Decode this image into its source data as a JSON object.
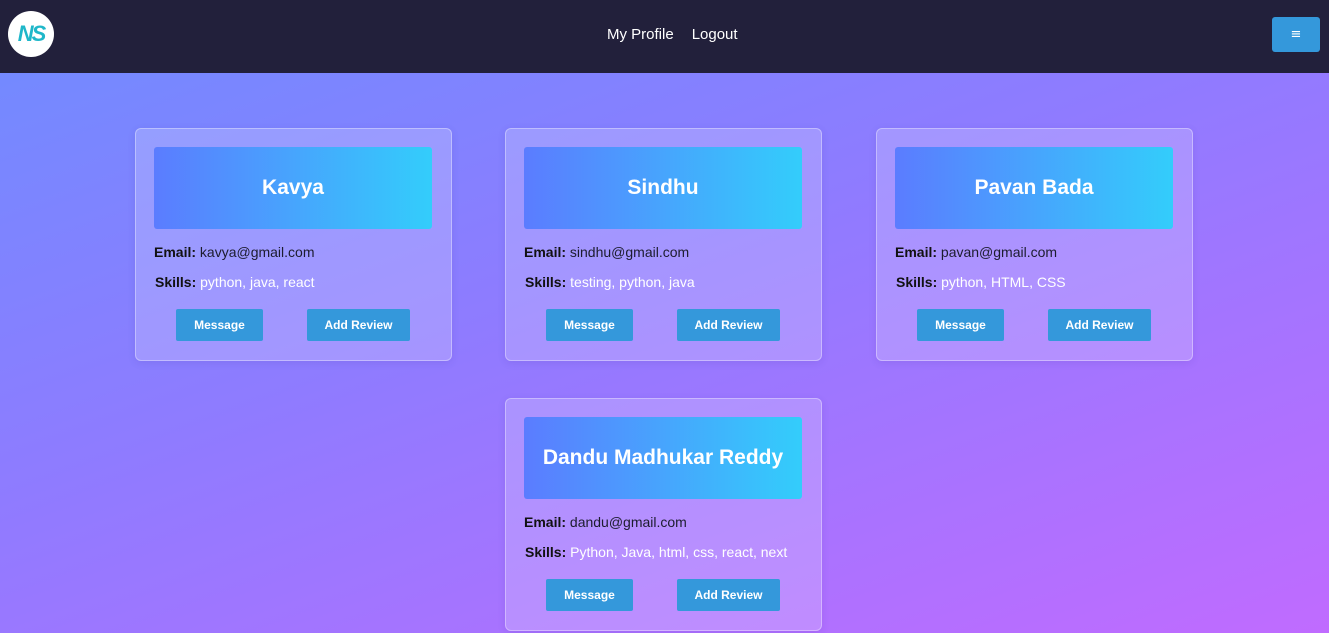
{
  "navbar": {
    "logo_text": "NS",
    "links": [
      {
        "label": "My Profile"
      },
      {
        "label": "Logout"
      }
    ],
    "menu_label": "≡"
  },
  "labels": {
    "email": "Email:",
    "skills": "Skills:",
    "message": "Message",
    "add_review": "Add Review"
  },
  "users": [
    {
      "name": "Kavya",
      "email": "kavya@gmail.com",
      "skills": "python, java, react"
    },
    {
      "name": "Sindhu",
      "email": "sindhu@gmail.com",
      "skills": "testing, python, java"
    },
    {
      "name": "Pavan Bada",
      "email": "pavan@gmail.com",
      "skills": "python, HTML, CSS"
    },
    {
      "name": "Dandu Madhukar Reddy",
      "email": "dandu@gmail.com",
      "skills": "Python, Java, html, css, react, next"
    }
  ],
  "colors": {
    "navbar": "#22203b",
    "button": "#3498db",
    "header_gradient_start": "#5b7cff",
    "header_gradient_end": "#33cdfb"
  }
}
